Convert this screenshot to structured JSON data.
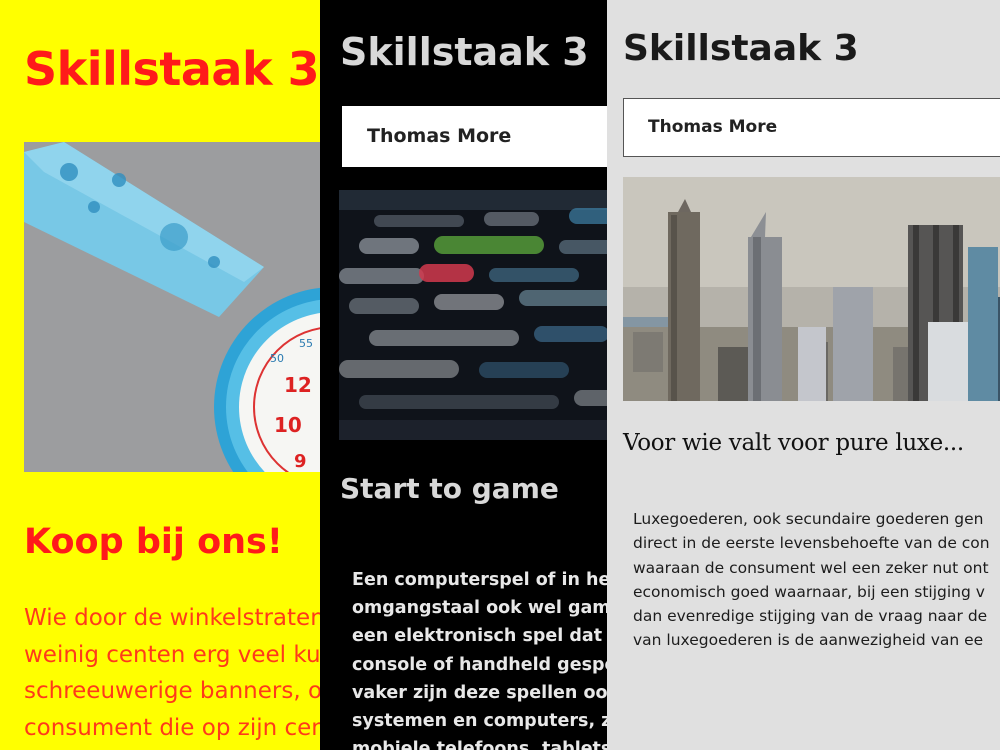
{
  "panels": [
    {
      "id": "yellow",
      "title": "Skillstaak 3",
      "image_alt": "watch",
      "subtitle": "Koop bij ons!",
      "body_lines": [
        "Wie door de winkelstraten",
        "weinig centen erg veel ku",
        "schreeuwerige banners, o",
        "consument die op zijn cen"
      ],
      "colors": {
        "background": "#ffff00",
        "text": "#ff1a1a"
      }
    },
    {
      "id": "dark",
      "title": "Skillstaak 3",
      "org": "Thomas More",
      "image_alt": "code",
      "subtitle": "Start to game",
      "body_lines": [
        "Een computerspel of in het E",
        "omgangstaal ook wel game",
        "een elektronisch spel dat op",
        "console of handheld gespee",
        "vaker zijn deze spellen ook v",
        "systemen en computers, zoa",
        "mobiele telefoons, tablets e"
      ],
      "colors": {
        "background": "#000000",
        "text": "#e8e8e8"
      }
    },
    {
      "id": "grey",
      "title": "Skillstaak 3",
      "org": "Thomas More",
      "image_alt": "skyline",
      "subtitle": "Voor wie valt voor pure luxe...",
      "body_lines": [
        "Luxegoederen, ook secundaire goederen gen",
        "direct in de eerste levensbehoefte van de con",
        "waaraan de consument wel een zeker nut ont",
        "economisch goed waarnaar, bij een stijging v",
        "dan evenredige stijging van de vraag naar de",
        "van luxegoederen is de aanwezigheid van ee"
      ],
      "colors": {
        "background": "#e0e0e0",
        "text": "#1a1a1a"
      }
    }
  ]
}
